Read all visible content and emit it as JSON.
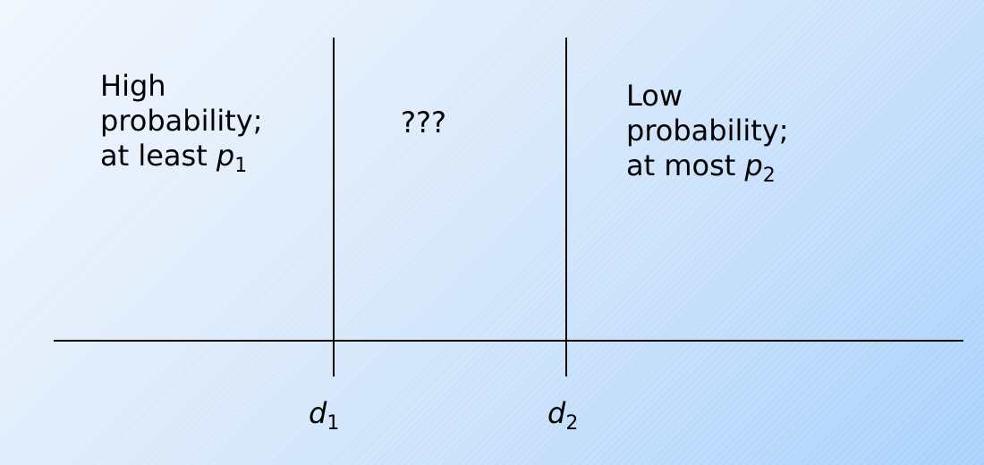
{
  "diagram": {
    "left_region": {
      "line1": "High",
      "line2": "probability;",
      "line3_prefix": "at least ",
      "var": "p",
      "sub": "1"
    },
    "middle_region": {
      "text": "???"
    },
    "right_region": {
      "line1": "Low",
      "line2": "probability;",
      "line3_prefix": "at most ",
      "var": "p",
      "sub": "2"
    },
    "tick_d1": {
      "var": "d",
      "sub": "1"
    },
    "tick_d2": {
      "var": "d",
      "sub": "2"
    }
  }
}
